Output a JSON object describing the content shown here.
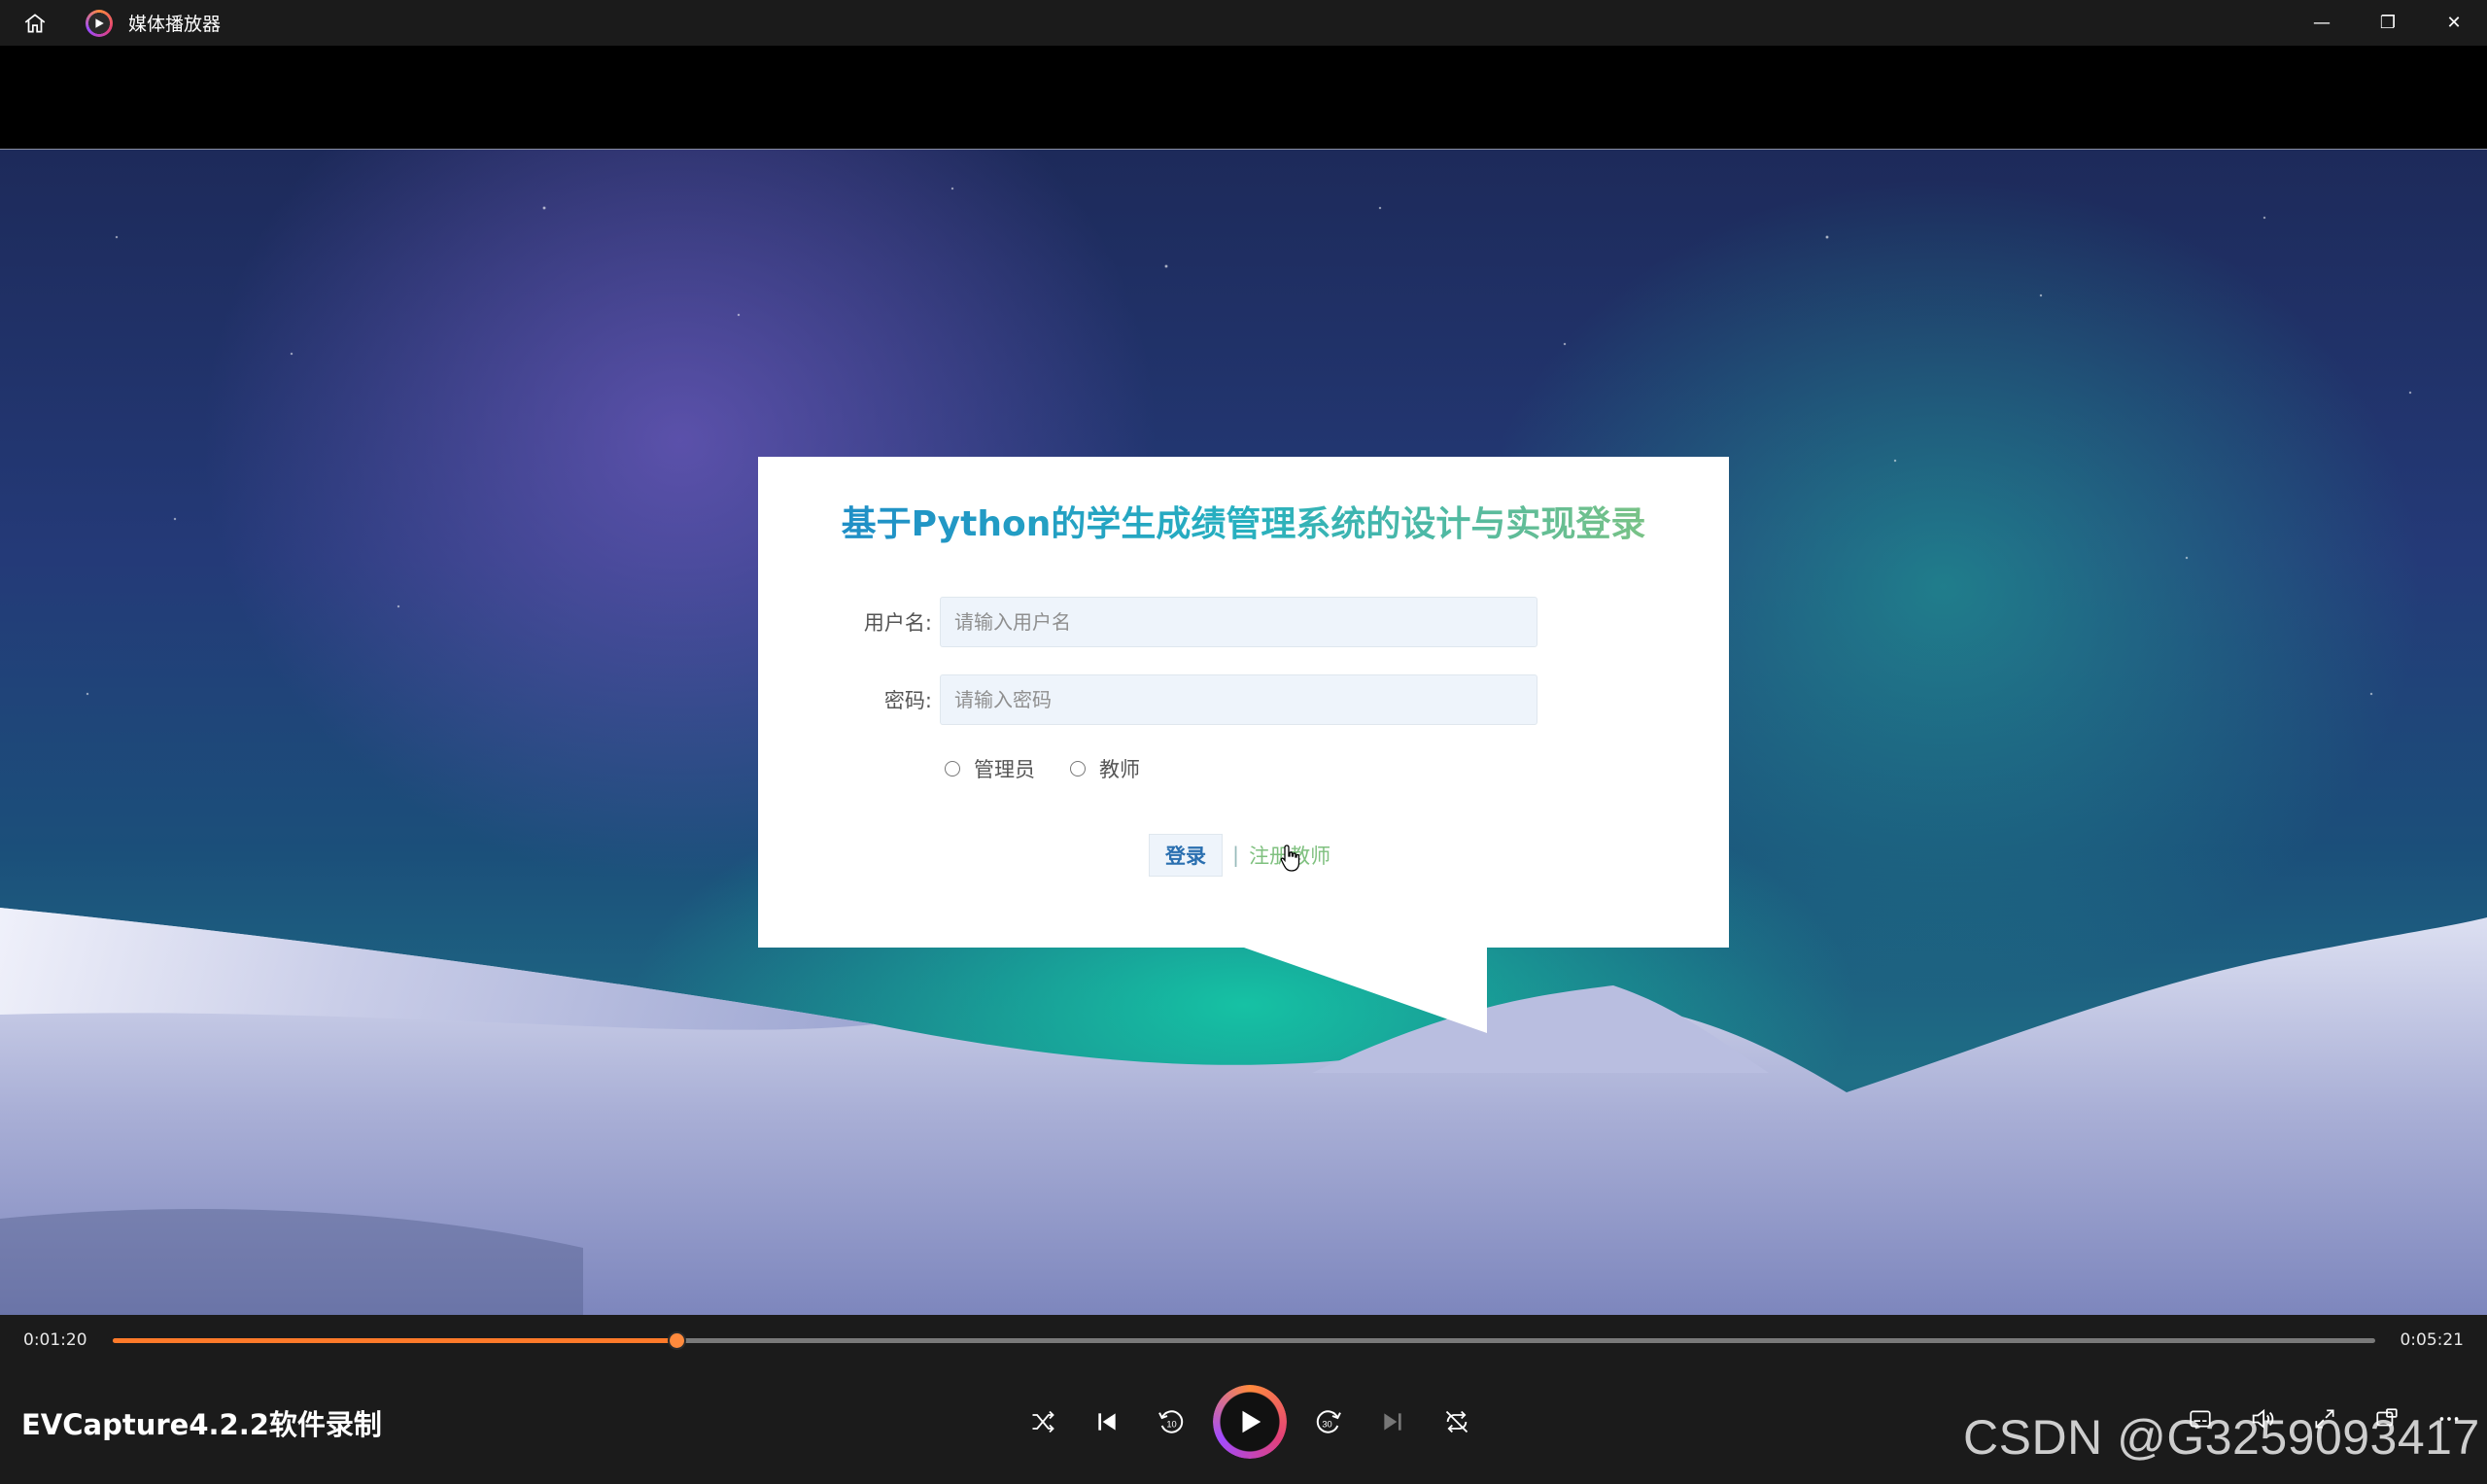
{
  "window": {
    "app_title": "媒体播放器",
    "controls": {
      "minimize": "—",
      "restore": "❐",
      "close": "✕"
    }
  },
  "video": {
    "login": {
      "title": "基于Python的学生成绩管理系统的设计与实现登录",
      "username_label": "用户名:",
      "username_placeholder": "请输入用户名",
      "password_label": "密码:",
      "password_placeholder": "请输入密码",
      "roles": [
        "管理员",
        "教师"
      ],
      "login_button": "登录",
      "separator": "|",
      "register_link": "注册教师"
    }
  },
  "player": {
    "elapsed": "0:01:20",
    "duration": "0:05:21",
    "progress_fraction": 0.249,
    "media_title": "EVCapture4.2.2软件录制"
  },
  "watermark": "CSDN @G3259093417",
  "colors": {
    "accent_orange": "#ff7a2a",
    "title_blue": "#1e88c8",
    "link_green": "#7fc07f"
  }
}
